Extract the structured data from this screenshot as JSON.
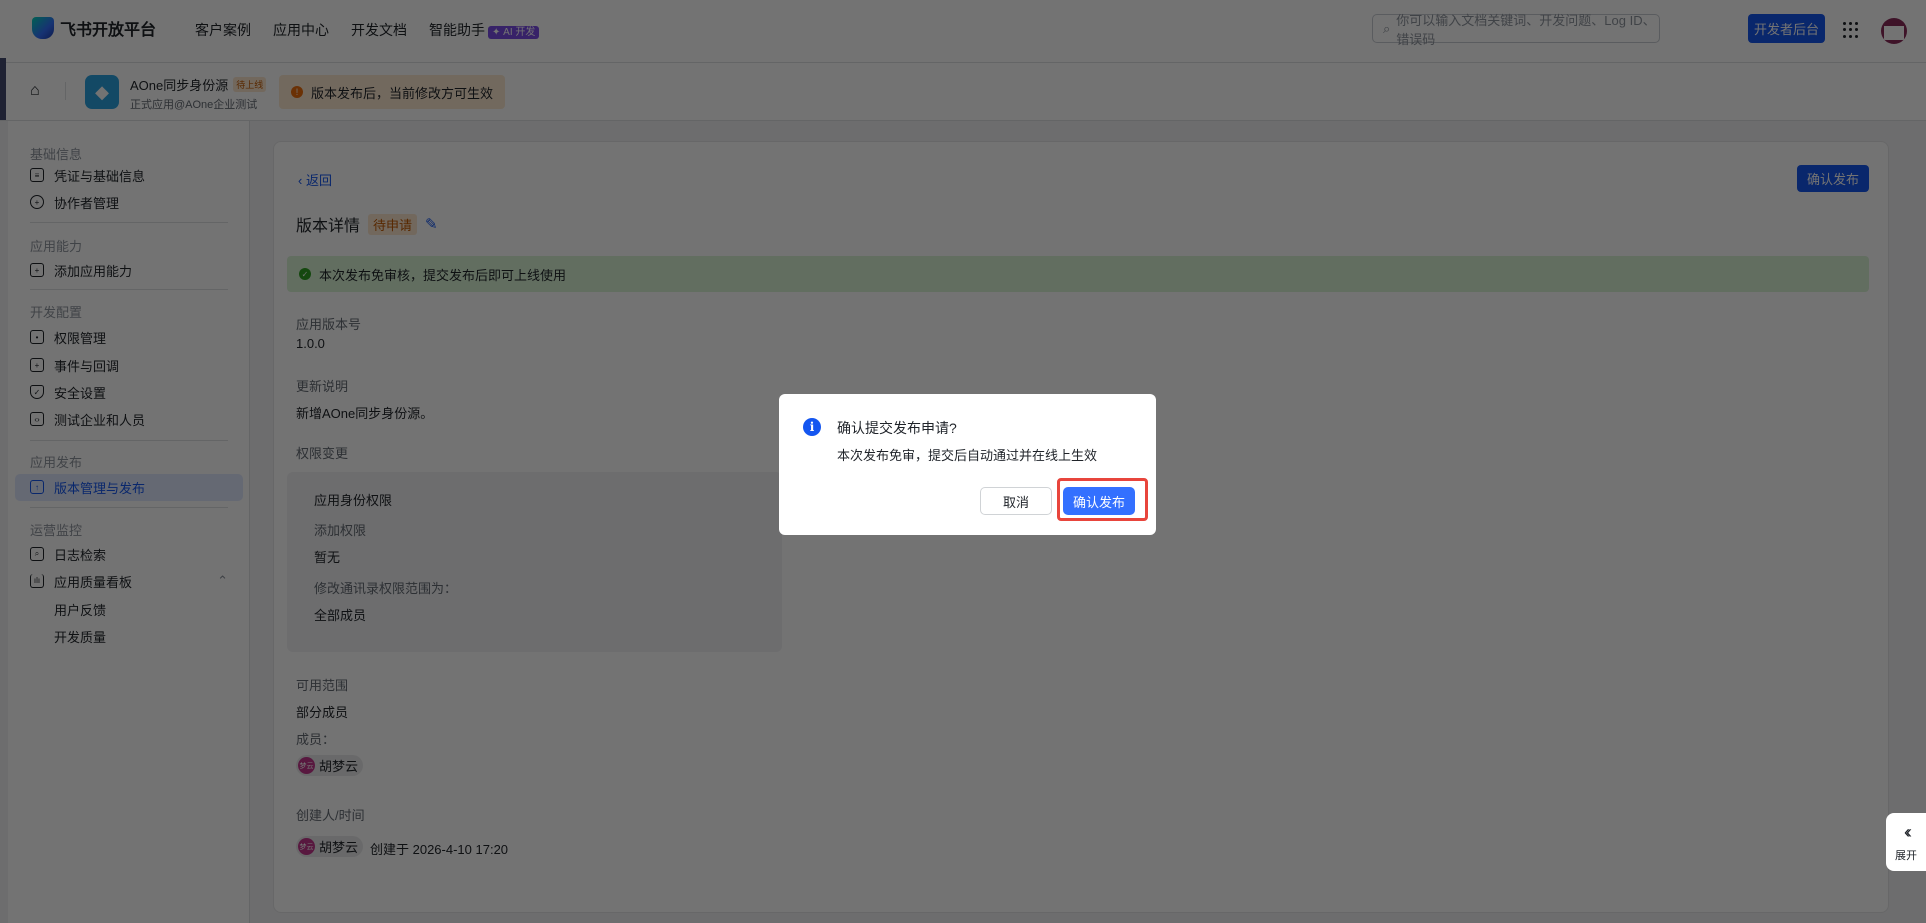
{
  "header": {
    "brand": "飞书开放平台",
    "nav": [
      "客户案例",
      "应用中心",
      "开发文档",
      "智能助手"
    ],
    "ai_badge": "✦ AI 开发",
    "search_placeholder": "你可以输入文档关键词、开发问题、Log ID、错误码",
    "dev_console": "开发者后台"
  },
  "app": {
    "name": "AOne同步身份源",
    "status": "待上线",
    "subtitle": "正式应用@AOne企业测试",
    "notice": "版本发布后，当前修改方可生效"
  },
  "sidebar": {
    "sections": [
      {
        "title": "基础信息",
        "items": [
          "凭证与基础信息",
          "协作者管理"
        ]
      },
      {
        "title": "应用能力",
        "items": [
          "添加应用能力"
        ]
      },
      {
        "title": "开发配置",
        "items": [
          "权限管理",
          "事件与回调",
          "安全设置",
          "测试企业和人员"
        ]
      },
      {
        "title": "应用发布",
        "items": [
          "版本管理与发布"
        ]
      },
      {
        "title": "运营监控",
        "items": [
          "日志检索",
          "应用质量看板"
        ],
        "subitems": [
          "用户反馈",
          "开发质量"
        ]
      }
    ],
    "active": "版本管理与发布"
  },
  "main": {
    "back": "返回",
    "title": "版本详情",
    "status": "待申请",
    "confirm_publish": "确认发布",
    "banner": "本次发布免审核，提交发布后即可上线使用",
    "version_label": "应用版本号",
    "version": "1.0.0",
    "notes_label": "更新说明",
    "notes": "新增AOne同步身份源。",
    "perm_label": "权限变更",
    "perm_title": "应用身份权限",
    "perm_add_label": "添加权限",
    "perm_add": "暂无",
    "perm_scope_label": "修改通讯录权限范围为：",
    "perm_scope": "全部成员",
    "range_label": "可用范围",
    "range": "部分成员",
    "members_label": "成员：",
    "member": "胡梦云",
    "member_avatar": "梦云",
    "creator_label": "创建人/时间",
    "creator": "胡梦云",
    "created": "创建于 2026-4-10 17:20"
  },
  "dialog": {
    "title": "确认提交发布申请?",
    "body": "本次发布免审，提交后自动通过并在线上生效",
    "cancel": "取消",
    "confirm": "确认发布"
  },
  "expand": {
    "label": "展开"
  }
}
